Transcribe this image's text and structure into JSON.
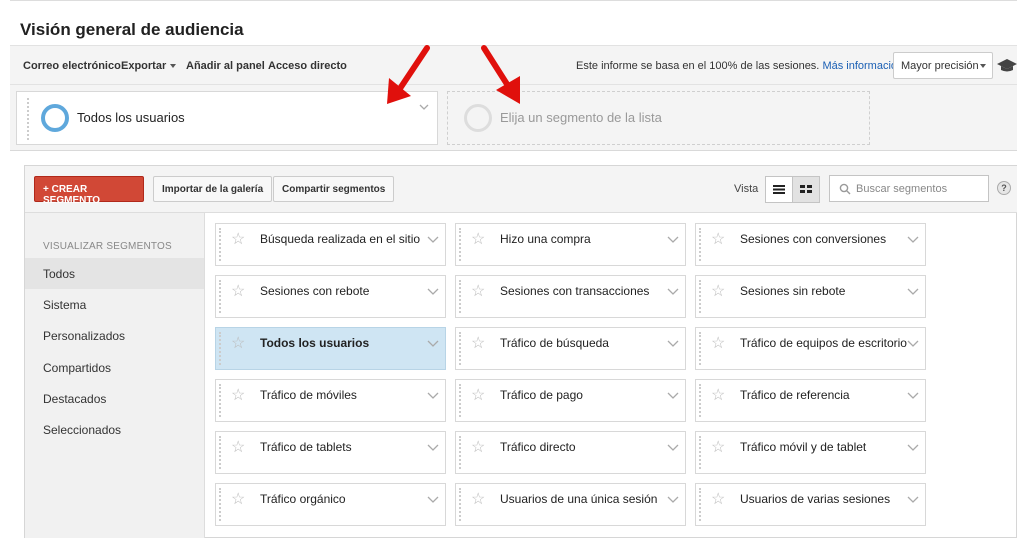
{
  "header": {
    "title": "Visión general de audiencia"
  },
  "toolbar": {
    "email": "Correo electrónico",
    "export": "Exportar",
    "add_panel": "Añadir al panel",
    "shortcut": "Acceso directo",
    "info": "Este informe se basa en el 100% de las sesiones.",
    "more_info": "Más información",
    "precision": "Mayor precisión"
  },
  "segments": {
    "active": "Todos los usuarios",
    "placeholder": "Elija un segmento de la lista"
  },
  "panel": {
    "create": "+ CREAR SEGMENTO",
    "import": "Importar de la galería",
    "share": "Compartir segmentos",
    "view_label": "Vista",
    "search_placeholder": "Buscar segmentos",
    "help": "?"
  },
  "sidebar": {
    "heading": "VISUALIZAR SEGMENTOS",
    "items": [
      "Todos",
      "Sistema",
      "Personalizados",
      "Compartidos",
      "Destacados",
      "Seleccionados"
    ]
  },
  "tiles": [
    [
      "Búsqueda realizada en el sitio",
      "Hizo una compra",
      "Sesiones con conversiones"
    ],
    [
      "Sesiones con rebote",
      "Sesiones con transacciones",
      "Sesiones sin rebote"
    ],
    [
      "Todos los usuarios",
      "Tráfico de búsqueda",
      "Tráfico de equipos de escritorio"
    ],
    [
      "Tráfico de móviles",
      "Tráfico de pago",
      "Tráfico de referencia"
    ],
    [
      "Tráfico de tablets",
      "Tráfico directo",
      "Tráfico móvil y de tablet"
    ],
    [
      "Tráfico orgánico",
      "Usuarios de una única sesión",
      "Usuarios de varias sesiones"
    ]
  ],
  "colors": {
    "accent_red": "#d14836",
    "selected_tile": "#cfe5f3",
    "arrow_red": "#e0100c",
    "ring_blue": "#5fa8dc"
  }
}
